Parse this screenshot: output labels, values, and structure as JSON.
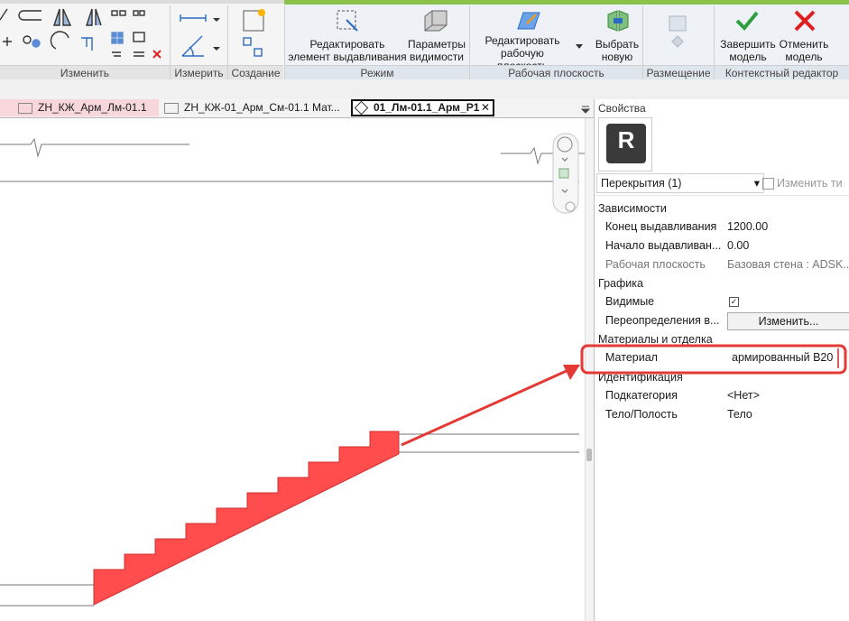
{
  "ribbon": {
    "panels": {
      "modify": "Изменить",
      "measure": "Измерить",
      "create": "Создание",
      "mode": "Режим",
      "work_plane": "Рабочая плоскость",
      "placement": "Размещение",
      "context_editor": "Контекстный редактор"
    },
    "buttons": {
      "edit_extrusion": [
        "Редактировать",
        "элемент выдавливания"
      ],
      "visibility_params": [
        "Параметры",
        "видимости"
      ],
      "edit_work_plane": [
        "Редактировать",
        "рабочую плоскость"
      ],
      "pick_new": [
        "Выбрать",
        "новую"
      ],
      "finish_model": [
        "Завершить",
        "модель"
      ],
      "cancel_model": [
        "Отменить",
        "модель"
      ]
    }
  },
  "tabs": [
    {
      "label": "ZH_КЖ_Арм_Лм-01.1"
    },
    {
      "label": "ZH_КЖ-01_Арм_См-01.1 Мат..."
    },
    {
      "label": "01_Лм-01.1_Арм_Р1"
    }
  ],
  "properties": {
    "title": "Свойства",
    "logo_letter": "R",
    "type_selector": "Перекрытия (1)",
    "edit_type": "Изменить ти",
    "groups": {
      "constraints": "Зависимости",
      "graphics": "Графика",
      "materials": "Материалы и отделка",
      "identity": "Идентификация"
    },
    "rows": {
      "extrusion_end": {
        "key": "Конец выдавливания",
        "value": "1200.00"
      },
      "extrusion_start": {
        "key": "Начало выдавливан...",
        "value": "0.00"
      },
      "work_plane": {
        "key": "Рабочая плоскость",
        "value": "Базовая стена : ADSK..."
      },
      "visible": {
        "key": "Видимые"
      },
      "overrides": {
        "key": "Переопределения в...",
        "value": "Изменить..."
      },
      "material": {
        "key": "Материал",
        "value": "армированный В20"
      },
      "subcategory": {
        "key": "Подкатегория",
        "value": "<Нет>"
      },
      "solid_void": {
        "key": "Тело/Полость",
        "value": "Тело"
      }
    }
  },
  "colors": {
    "highlight": "#e53935",
    "stair_fill": "#ff4d4d",
    "check_green": "#2e9e3f",
    "cancel_red": "#e02020",
    "context_strip": "#8bc34a",
    "pink_tab": "#f8d7dc"
  },
  "icons": [
    "check-icon",
    "x-icon",
    "close-icon",
    "dropdown-arrow-icon",
    "revit-logo-icon"
  ]
}
